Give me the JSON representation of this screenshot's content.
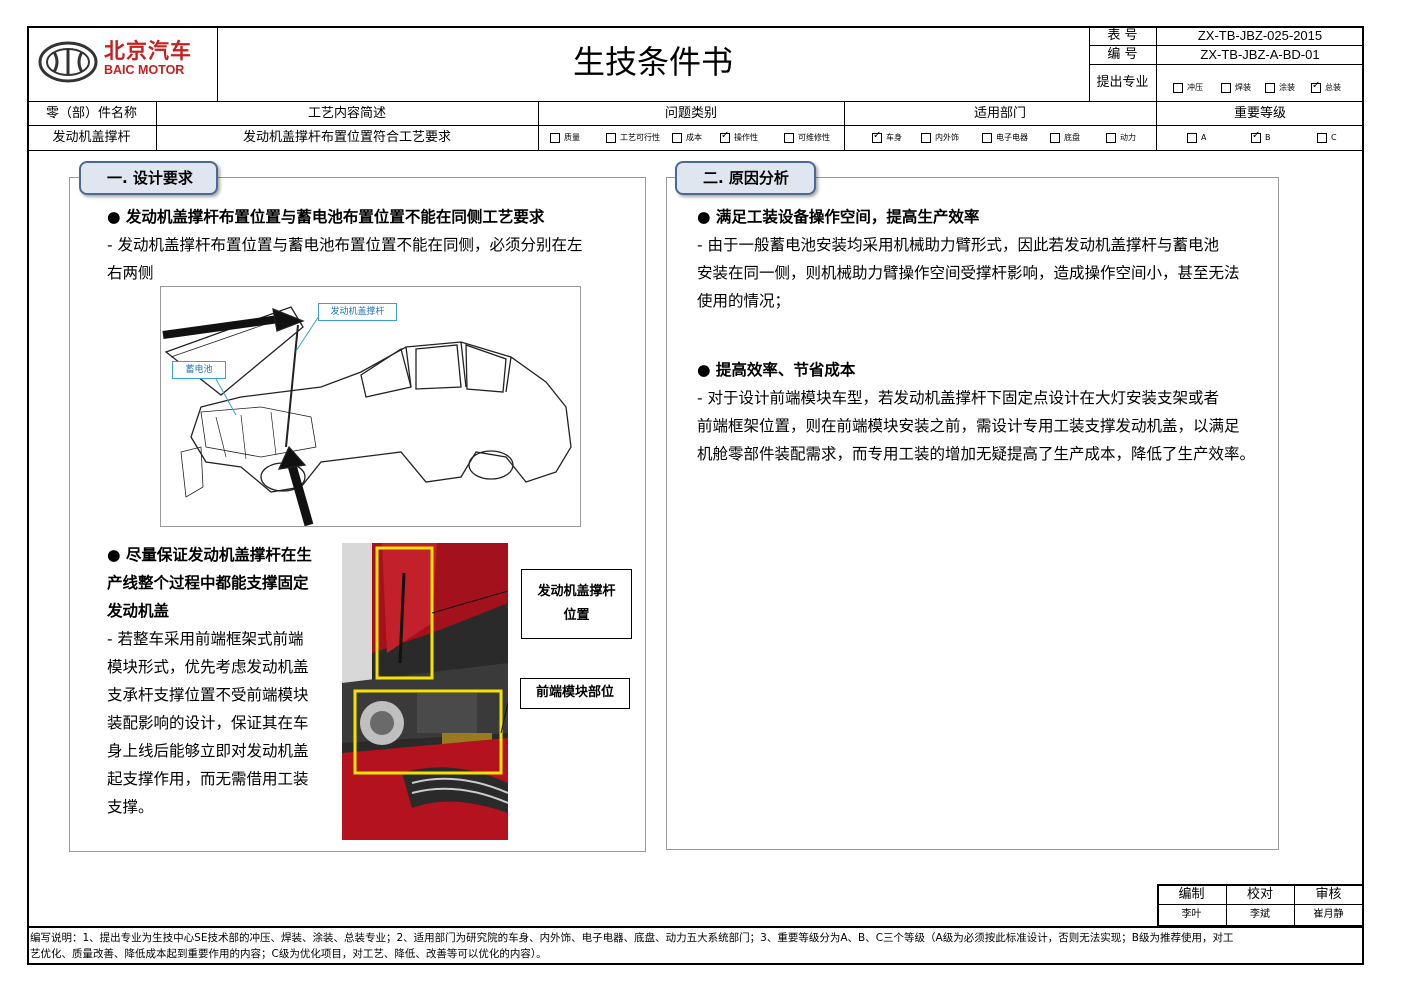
{
  "header": {
    "logo_cn": "北京汽车",
    "logo_en": "BAIC MOTOR",
    "title": "生技条件书",
    "form_no_label": "表 号",
    "form_no_value": "ZX-TB-JBZ-025-2015",
    "code_label": "编 号",
    "code_value": "ZX-TB-JBZ-A-BD-01",
    "proposer_label": "提出专业",
    "proposer_options": [
      {
        "label": "冲压",
        "checked": false
      },
      {
        "label": "焊装",
        "checked": false
      },
      {
        "label": "涂装",
        "checked": false
      },
      {
        "label": "总装",
        "checked": true
      }
    ]
  },
  "info_row": {
    "part_name_label": "零（部）件名称",
    "process_label": "工艺内容简述",
    "issue_label": "问题类别",
    "dept_label": "适用部门",
    "level_label": "重要等级",
    "part_name": "发动机盖撑杆",
    "process_desc": "发动机盖撑杆布置位置符合工艺要求",
    "issue_options": [
      {
        "label": "质量",
        "checked": false
      },
      {
        "label": "工艺可行性",
        "checked": false
      },
      {
        "label": "成本",
        "checked": false
      },
      {
        "label": "操作性",
        "checked": true
      },
      {
        "label": "可维修性",
        "checked": false
      }
    ],
    "dept_options": [
      {
        "label": "车身",
        "checked": true
      },
      {
        "label": "内外饰",
        "checked": false
      },
      {
        "label": "电子电器",
        "checked": false
      },
      {
        "label": "底盘",
        "checked": false
      },
      {
        "label": "动力",
        "checked": false
      }
    ],
    "level_options": [
      {
        "label": "A",
        "checked": false
      },
      {
        "label": "B",
        "checked": true
      },
      {
        "label": "C",
        "checked": false
      }
    ]
  },
  "design": {
    "tab": "一. 设计要求",
    "item1_title": "● 发动机盖撑杆布置位置与蓄电池布置位置不能在同侧工艺要求",
    "item1_line1": " - 发动机盖撑杆布置位置与蓄电池布置位置不能在同侧，必须分别在左",
    "item1_line2": "右两侧",
    "figure1_labels": {
      "strut": "发动机盖撑杆",
      "battery": "蓄电池"
    },
    "item2_title_lines": [
      "● 尽量保证发动机盖撑杆在生",
      "产线整个过程中都能支撑固定",
      "发动机盖"
    ],
    "item2_body_lines": [
      " - 若整车采用前端框架式前端",
      "模块形式，优先考虑发动机盖",
      "支承杆支撑位置不受前端模块",
      "装配影响的设计，保证其在车",
      "身上线后能够立即对发动机盖",
      "起支撑作用，而无需借用工装",
      "支撑。"
    ],
    "callout1_lines": [
      "发动机盖撑杆",
      "位置"
    ],
    "callout2": "前端模块部位"
  },
  "analysis": {
    "tab": "二. 原因分析",
    "item1_title": "● 满足工装设备操作空间，提高生产效率",
    "item1_lines": [
      " - 由于一般蓄电池安装均采用机械助力臂形式，因此若发动机盖撑杆与蓄电池",
      "安装在同一侧，则机械助力臂操作空间受撑杆影响，造成操作空间小，甚至无法",
      "使用的情况；"
    ],
    "item2_title": "● 提高效率、节省成本",
    "item2_lines": [
      " - 对于设计前端模块车型，若发动机盖撑杆下固定点设计在大灯安装支架或者",
      "前端框架位置，则在前端模块安装之前，需设计专用工装支撑发动机盖，以满足",
      "机舱零部件装配需求，而专用工装的增加无疑提高了生产成本，降低了生产效率。"
    ]
  },
  "signoff": {
    "prepared_label": "编制",
    "checked_label": "校对",
    "approved_label": "审核",
    "prepared": "李叶",
    "checked": "李斌",
    "approved": "崔月静"
  },
  "notes": {
    "line1": "编写说明：1、提出专业为生技中心SE技术部的冲压、焊装、涂装、总装专业；2、适用部门为研究院的车身、内外饰、电子电器、底盘、动力五大系统部门；3、重要等级分为A、B、C三个等级（A级为必须按此标准设计，否则无法实现；B级为推荐使用，对工",
    "line2": "艺优化、质量改善、降低成本起到重要作用的内容；C级为优化项目，对工艺、降低、改善等可以优化的内容）。"
  },
  "colors": {
    "tab_border": "#4a6a95",
    "tab_fill": "#dfe6ef",
    "highlight": "#f2e400",
    "label_blue": "#2277bb"
  }
}
